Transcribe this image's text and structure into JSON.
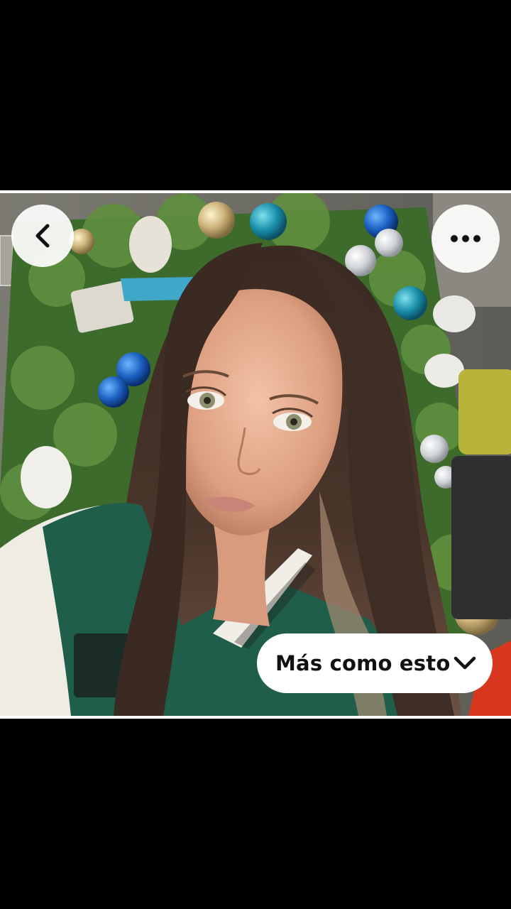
{
  "photo": {
    "description_icon": "portrait-photo"
  },
  "nav": {
    "back_icon": "chevron-left-icon",
    "more_icon": "ellipsis-icon"
  },
  "more_like_this": {
    "label": "Más como esto",
    "icon": "chevron-down-icon"
  },
  "colors": {
    "background": "#000000",
    "button": "#ffffff",
    "text": "#111111"
  }
}
